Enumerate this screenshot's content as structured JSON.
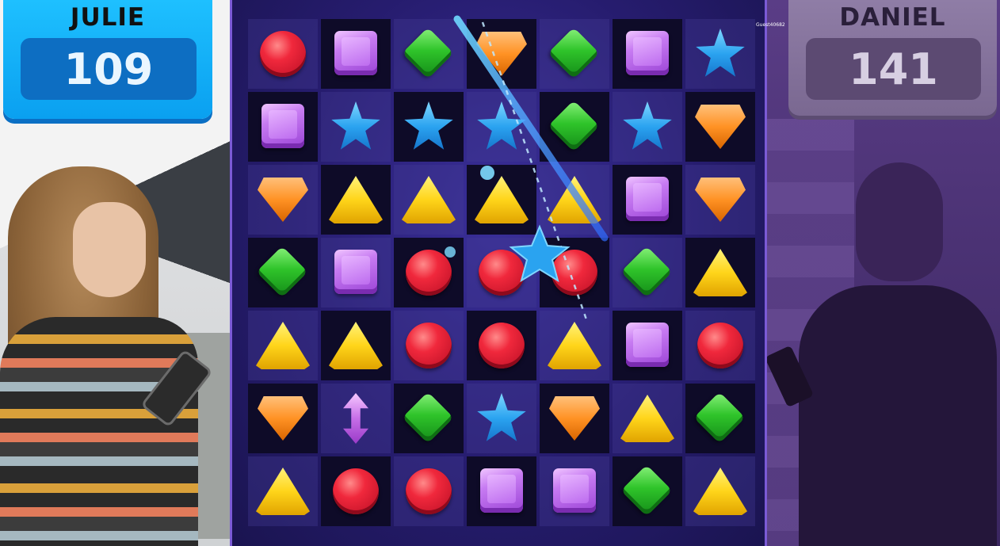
{
  "players": {
    "left": {
      "name": "JULIE",
      "score": "109",
      "accent": "#0aa0f0"
    },
    "right": {
      "name": "DANIEL",
      "score": "141",
      "accent": "#7a6891"
    }
  },
  "board": {
    "label": "Guest40682",
    "rows": [
      [
        "red",
        "purple",
        "green",
        "orange",
        "green",
        "purple",
        "blue"
      ],
      [
        "purple",
        "blue",
        "blue",
        "blue",
        "green",
        "blue",
        "orange"
      ],
      [
        "orange",
        "yellow",
        "yellow",
        "yellow",
        "yellow",
        "purple",
        "orange"
      ],
      [
        "green",
        "purple",
        "red",
        "red",
        "red",
        "green",
        "yellow"
      ],
      [
        "yellow",
        "yellow",
        "red",
        "red",
        "yellow",
        "purple",
        "red"
      ],
      [
        "orange",
        "arrow",
        "green",
        "blue",
        "orange",
        "yellow",
        "green"
      ],
      [
        "yellow",
        "red",
        "red",
        "purple",
        "purple",
        "green",
        "yellow"
      ]
    ],
    "cell_shade": [
      [
        "light",
        "dark",
        "light",
        "dark",
        "light",
        "dark",
        "light"
      ],
      [
        "dark",
        "light",
        "dark",
        "light",
        "dark",
        "light",
        "dark"
      ],
      [
        "light",
        "dark",
        "light",
        "dark",
        "light",
        "dark",
        "light"
      ],
      [
        "dark",
        "light",
        "dark",
        "light",
        "dark",
        "light",
        "dark"
      ],
      [
        "light",
        "dark",
        "light",
        "dark",
        "light",
        "dark",
        "light"
      ],
      [
        "dark",
        "light",
        "dark",
        "light",
        "dark",
        "light",
        "dark"
      ],
      [
        "light",
        "dark",
        "light",
        "dark",
        "light",
        "dark",
        "light"
      ]
    ],
    "moving_gem": "blue",
    "colors": {
      "board_border": "#7b5ad6",
      "board_bg": "#261c6e"
    }
  }
}
